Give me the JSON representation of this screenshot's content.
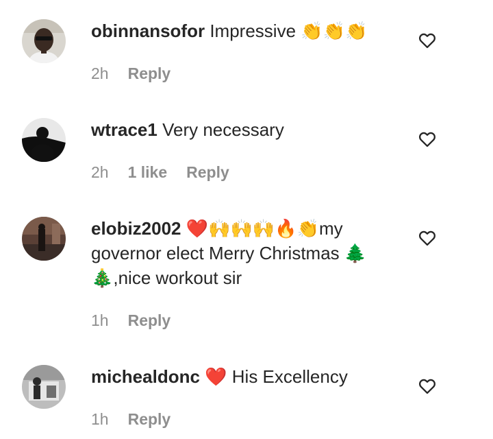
{
  "comments": [
    {
      "username": "obinnansofor",
      "text": "Impressive 👏👏👏",
      "time": "2h",
      "likes": "",
      "reply": "Reply",
      "avatar_icon": "user-avatar-sunglasses"
    },
    {
      "username": "wtrace1",
      "text": "Very necessary",
      "time": "2h",
      "likes": "1 like",
      "reply": "Reply",
      "avatar_icon": "user-avatar-silhouette"
    },
    {
      "username": "elobiz2002",
      "text": "❤️🙌🙌🙌🔥👏my governor elect Merry Christmas 🌲🎄,nice workout sir",
      "time": "1h",
      "likes": "",
      "reply": "Reply",
      "avatar_icon": "user-avatar-street"
    },
    {
      "username": "michealdonc",
      "text": "❤️ His Excellency",
      "time": "1h",
      "likes": "",
      "reply": "Reply",
      "avatar_icon": "user-avatar-bw"
    }
  ],
  "colors": {
    "text": "#262626",
    "meta": "#8e8e8e",
    "background": "#ffffff"
  },
  "icons": {
    "like": "heart-outline-icon"
  }
}
